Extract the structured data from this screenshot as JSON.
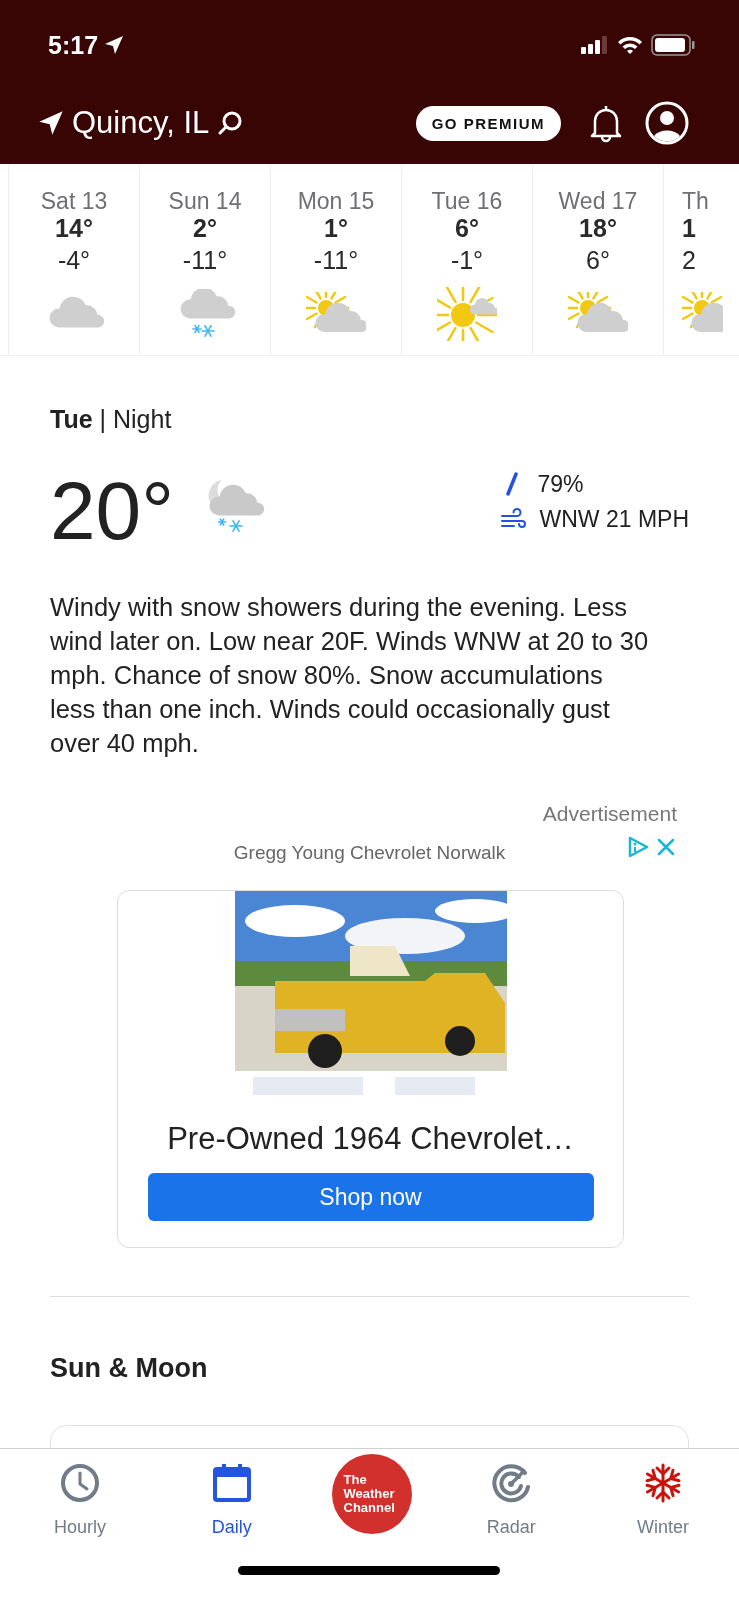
{
  "status_bar": {
    "time": "5:17"
  },
  "header": {
    "location": "Quincy, IL",
    "premium_button": "GO PREMIUM"
  },
  "days": [
    {
      "day": "Sat 13",
      "high": "14°",
      "low": "-4°",
      "kind": "cloudy"
    },
    {
      "day": "Sun 14",
      "high": "2°",
      "low": "-11°",
      "kind": "snow"
    },
    {
      "day": "Mon 15",
      "high": "1°",
      "low": "-11°",
      "kind": "partly-sunny"
    },
    {
      "day": "Tue 16",
      "high": "6°",
      "low": "-1°",
      "kind": "sunny"
    },
    {
      "day": "Wed 17",
      "high": "18°",
      "low": "6°",
      "kind": "partly-sunny"
    },
    {
      "day": "Th",
      "high": "1",
      "low": "2",
      "kind": "partly-sunny"
    }
  ],
  "detail": {
    "title": "**Tue** | Night",
    "temperature": "20°",
    "kind": "night-snow",
    "precipitation": "79%",
    "wind": "WNW 21 MPH",
    "description": "Windy with snow showers during the evening. Less wind later on. Low near 20F. Winds WNW at 20 to 30 mph. Chance of snow 80%. Snow accumulations less than one inch.  Winds could occasionally gust over 40 mph."
  },
  "ad": {
    "label": "Advertisement",
    "advertiser": "Gregg Young Chevrolet Norwalk",
    "headline": "Pre-Owned 1964 Chevrolet…",
    "button": "Shop now"
  },
  "sun_moon": {
    "title": "Sun & Moon"
  },
  "tabs": [
    {
      "label": "Hourly",
      "kind": "hourly",
      "selected": false
    },
    {
      "label": "Daily",
      "kind": "daily",
      "selected": true
    },
    {
      "label": "The Weather Channel",
      "kind": "logo",
      "selected": false
    },
    {
      "label": "Radar",
      "kind": "radar",
      "selected": false
    },
    {
      "label": "Winter",
      "kind": "winter",
      "selected": false
    }
  ]
}
